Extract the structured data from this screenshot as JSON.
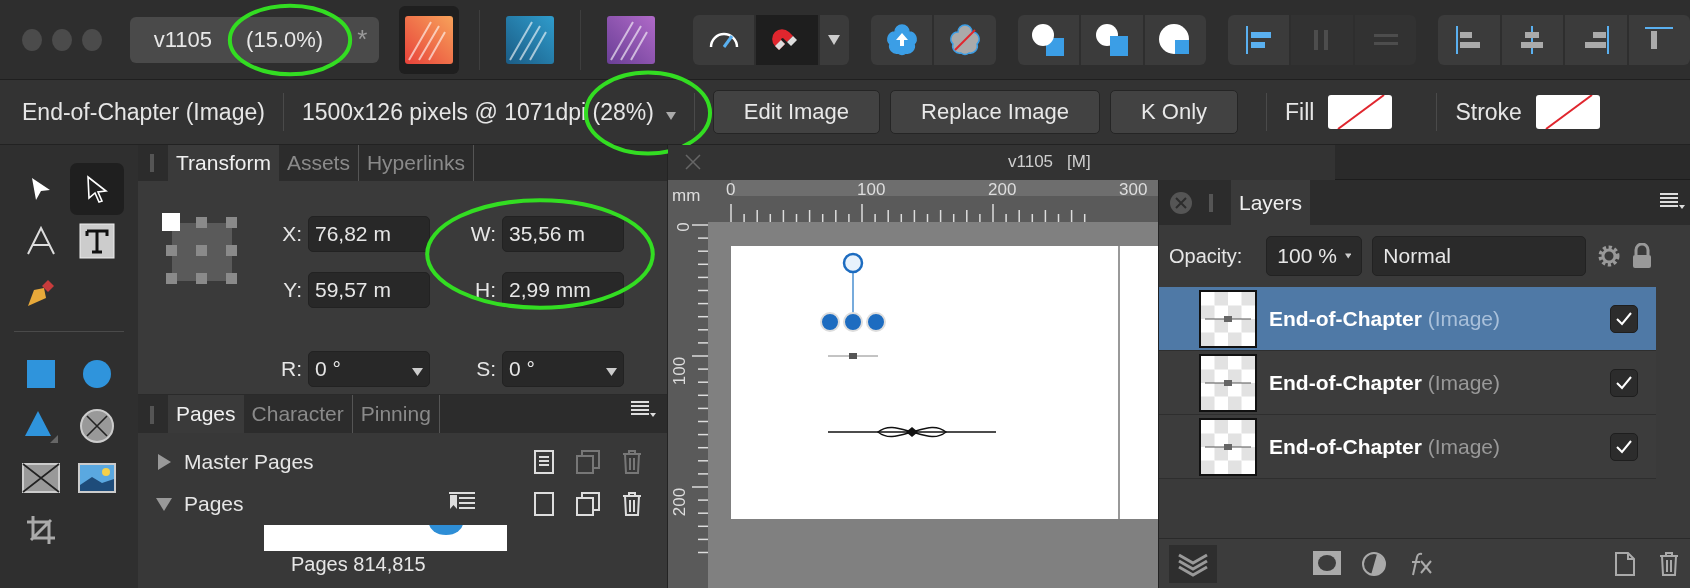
{
  "document_tab": {
    "title": "v1105",
    "zoom": "(15.0%)",
    "modified": "*"
  },
  "personas": [
    {
      "kind": "publisher",
      "selected": true
    },
    {
      "kind": "designer",
      "selected": false
    },
    {
      "kind": "photo",
      "selected": false
    }
  ],
  "toolbar_groups": [
    {
      "items": [
        {
          "kind": "gauge",
          "selected": false
        },
        {
          "kind": "magnet",
          "selected": true
        },
        {
          "kind": "caret",
          "selected": false
        }
      ]
    },
    {
      "items": [
        {
          "kind": "flower-up"
        },
        {
          "kind": "flower-off"
        }
      ]
    },
    {
      "items": [
        {
          "kind": "to-front"
        },
        {
          "kind": "forward"
        },
        {
          "kind": "back"
        }
      ]
    },
    {
      "items": [
        {
          "kind": "bars-left",
          "disabled": false
        },
        {
          "kind": "dist-h",
          "disabled": true
        },
        {
          "kind": "dist-v",
          "disabled": true
        }
      ]
    },
    {
      "items": [
        {
          "kind": "align-left"
        },
        {
          "kind": "align-center"
        },
        {
          "kind": "align-right"
        },
        {
          "kind": "align-top"
        }
      ]
    }
  ],
  "context_bar": {
    "selection": "End-of-Chapter (Image)",
    "info": "1500x126 pixels @ 1071dpi (28%)",
    "buttons": [
      "Edit Image",
      "Replace Image",
      "K Only"
    ],
    "fill_label": "Fill",
    "stroke_label": "Stroke"
  },
  "tool_groups": [
    {
      "tools": [
        {
          "kind": "move",
          "selected": false
        },
        {
          "kind": "node",
          "selected": true
        },
        {
          "kind": "artistic-text",
          "selected": false
        },
        {
          "kind": "frame-text",
          "selected": false
        },
        {
          "kind": "pen",
          "selected": false
        }
      ]
    },
    {
      "tools": [
        {
          "kind": "rectangle",
          "selected": false
        },
        {
          "kind": "ellipse",
          "selected": false
        },
        {
          "kind": "triangle",
          "selected": false
        },
        {
          "kind": "circle-x",
          "selected": false
        },
        {
          "kind": "frame-x",
          "selected": false
        },
        {
          "kind": "image",
          "selected": false
        },
        {
          "kind": "crop",
          "selected": false
        }
      ]
    }
  ],
  "transform_panel": {
    "tabs": [
      {
        "label": "Transform",
        "selected": true
      },
      {
        "label": "Assets",
        "selected": false
      },
      {
        "label": "Hyperlinks",
        "selected": false
      }
    ],
    "fields": [
      {
        "label": "X:",
        "value": "76,82 m",
        "kind": "text"
      },
      {
        "label": "W:",
        "value": "35,56 m",
        "kind": "text"
      },
      {
        "label": "Y:",
        "value": "59,57 m",
        "kind": "text"
      },
      {
        "label": "H:",
        "value": "2,99 mm",
        "kind": "text"
      },
      {
        "label": "R:",
        "value": "0 °",
        "kind": "dropdown"
      },
      {
        "label": "S:",
        "value": "0 °",
        "kind": "dropdown"
      }
    ]
  },
  "pages_panel": {
    "tabs": [
      {
        "label": "Pages",
        "selected": true
      },
      {
        "label": "Character",
        "selected": false
      },
      {
        "label": "Pinning",
        "selected": false
      }
    ],
    "sections": [
      {
        "label": "Master Pages",
        "expanded": false
      },
      {
        "label": "Pages",
        "expanded": true
      }
    ],
    "thumbnail_label": "Pages 814,815"
  },
  "canvas": {
    "title": "v1105",
    "mode": "[M]",
    "unit": "mm",
    "x_ticks": [
      "0",
      "100",
      "200",
      "300"
    ],
    "y_ticks": [
      "0",
      "100",
      "200"
    ]
  },
  "layers_panel": {
    "tab": "Layers",
    "opacity_label": "Opacity:",
    "opacity": "100 %",
    "blend_mode": "Normal",
    "rows": [
      {
        "name": "End-of-Chapter",
        "type": "(Image)",
        "selected": true,
        "visible": true
      },
      {
        "name": "End-of-Chapter",
        "type": "(Image)",
        "selected": false,
        "visible": true
      },
      {
        "name": "End-of-Chapter",
        "type": "(Image)",
        "selected": false,
        "visible": true
      }
    ]
  }
}
